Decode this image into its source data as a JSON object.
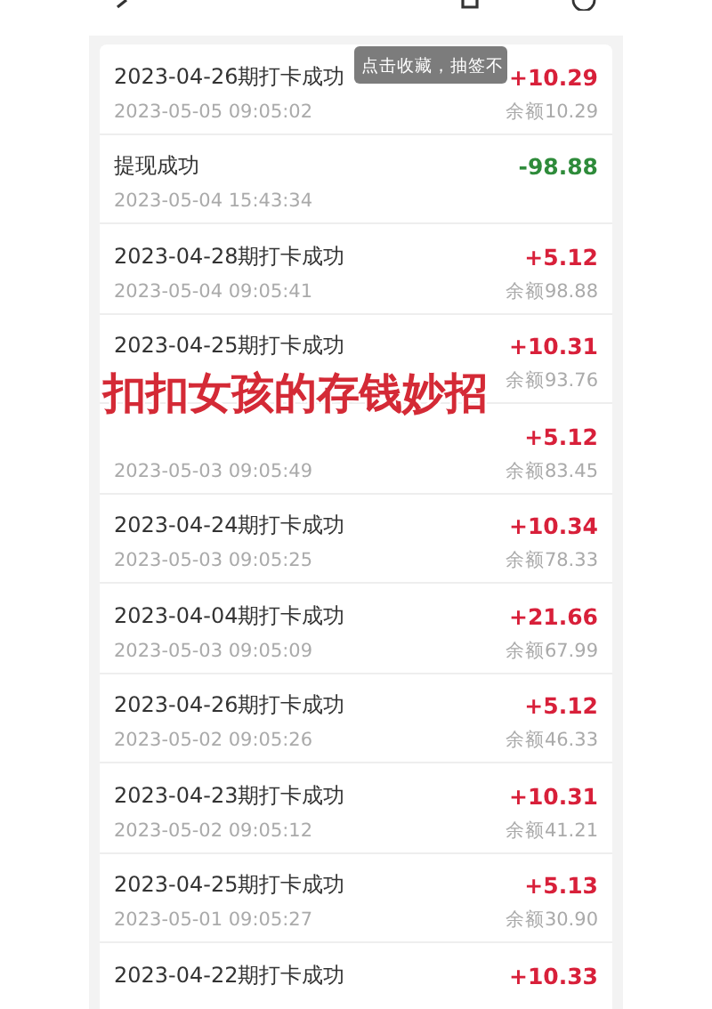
{
  "tooltip": "点击收藏，抽签不",
  "caption": "扣扣女孩的存钱妙招",
  "rows": [
    {
      "kind": "income",
      "title": "2023-04-26期打卡成功",
      "time": "2023-05-05 09:05:02",
      "amount": "+10.29",
      "balance": "余额10.29"
    },
    {
      "kind": "withdraw",
      "title": "提现成功",
      "time": "2023-05-04 15:43:34",
      "amount": "-98.88"
    },
    {
      "kind": "income",
      "title": "2023-04-28期打卡成功",
      "time": "2023-05-04 09:05:41",
      "amount": "+5.12",
      "balance": "余额98.88"
    },
    {
      "kind": "income",
      "title": "2023-04-25期打卡成功",
      "amount": "+10.31",
      "balance": "余额93.76"
    },
    {
      "kind": "income",
      "time": "2023-05-03 09:05:49",
      "amount": "+5.12",
      "balance": "余额83.45"
    },
    {
      "kind": "income",
      "title": "2023-04-24期打卡成功",
      "time": "2023-05-03 09:05:25",
      "amount": "+10.34",
      "balance": "余额78.33"
    },
    {
      "kind": "income",
      "title": "2023-04-04期打卡成功",
      "time": "2023-05-03 09:05:09",
      "amount": "+21.66",
      "balance": "余额67.99"
    },
    {
      "kind": "income",
      "title": "2023-04-26期打卡成功",
      "time": "2023-05-02 09:05:26",
      "amount": "+5.12",
      "balance": "余额46.33"
    },
    {
      "kind": "income",
      "title": "2023-04-23期打卡成功",
      "time": "2023-05-02 09:05:12",
      "amount": "+10.31",
      "balance": "余额41.21"
    },
    {
      "kind": "income",
      "title": "2023-04-25期打卡成功",
      "time": "2023-05-01 09:05:27",
      "amount": "+5.13",
      "balance": "余额30.90"
    },
    {
      "kind": "income",
      "title": "2023-04-22期打卡成功",
      "amount": "+10.33"
    }
  ]
}
